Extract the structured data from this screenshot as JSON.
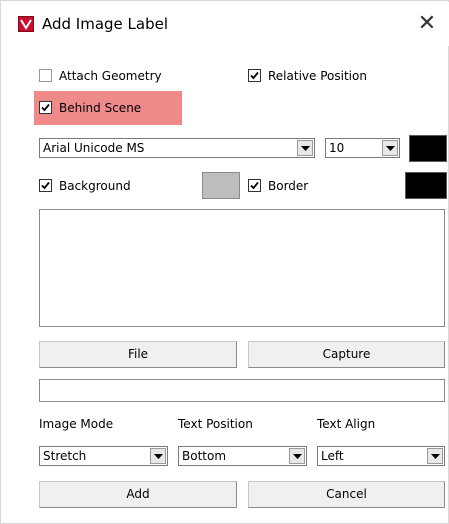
{
  "window": {
    "title": "Add Image Label",
    "close_glyph": "✕"
  },
  "options": {
    "attach_geometry": {
      "label": "Attach Geometry",
      "checked": false
    },
    "relative_position": {
      "label": "Relative Position",
      "checked": true
    },
    "behind_scene": {
      "label": "Behind Scene",
      "checked": true,
      "highlight_color": "#ef8a8a"
    }
  },
  "font": {
    "family": "Arial Unicode MS",
    "size": "10",
    "color": "#000000"
  },
  "background": {
    "label": "Background",
    "checked": true,
    "color": "#bdbdbd"
  },
  "border": {
    "label": "Border",
    "checked": true,
    "color": "#000000"
  },
  "label_text": {
    "value": ""
  },
  "buttons": {
    "file": "File",
    "capture": "Capture",
    "add": "Add",
    "cancel": "Cancel"
  },
  "path_input": {
    "value": ""
  },
  "image_mode": {
    "label": "Image Mode",
    "value": "Stretch"
  },
  "text_position": {
    "label": "Text Position",
    "value": "Bottom"
  },
  "text_align": {
    "label": "Text Align",
    "value": "Left"
  }
}
